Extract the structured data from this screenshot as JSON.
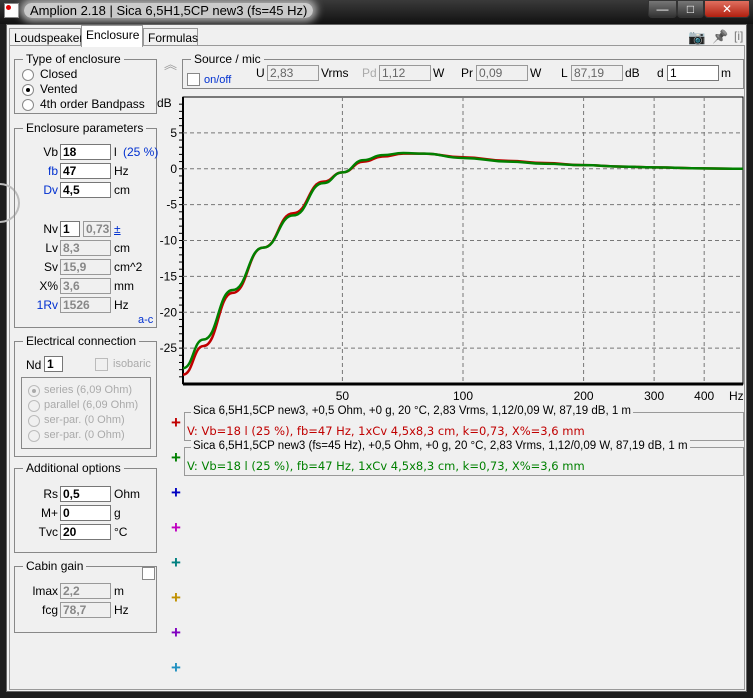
{
  "window": {
    "title": "Amplion 2.18 | Sica 6,5H1,5CP new3 (fs=45 Hz)",
    "minimize": "—",
    "maximize": "□",
    "close": "✕"
  },
  "tabs": [
    {
      "label": "Loudspeaker"
    },
    {
      "label": "Enclosure"
    },
    {
      "label": "Formulas"
    }
  ],
  "toolbar": {
    "camera": "📷",
    "pin": "📌",
    "info": "[i]"
  },
  "type_of_enclosure": {
    "title": "Type of enclosure",
    "options": [
      "Closed",
      "Vented",
      "4th order Bandpass"
    ],
    "selected": "Vented"
  },
  "enclosure_parameters": {
    "title": "Enclosure parameters",
    "vb": {
      "label": "Vb",
      "value": "18",
      "unit": "l",
      "extra": "(25 %)"
    },
    "fb": {
      "label": "fb",
      "value": "47",
      "unit": "Hz"
    },
    "dv": {
      "label": "Dv",
      "value": "4,5",
      "unit": "cm"
    },
    "nv": {
      "label": "Nv",
      "value": "1",
      "k": "0,73",
      "pm": "±"
    },
    "lv": {
      "label": "Lv",
      "value": "8,3",
      "unit": "cm"
    },
    "sv": {
      "label": "Sv",
      "value": "15,9",
      "unit": "cm^2"
    },
    "xp": {
      "label": "X%",
      "value": "3,6",
      "unit": "mm"
    },
    "rv": {
      "label": "1Rv",
      "value": "1526",
      "unit": "Hz"
    },
    "ac": "a-c"
  },
  "electrical": {
    "title": "Electrical connection",
    "nd_label": "Nd",
    "nd": "1",
    "isobaric": "isobaric",
    "options": [
      "series (6,09 Ohm)",
      "parallel (6,09 Ohm)",
      "ser-par. (0 Ohm)",
      "ser-par. (0 Ohm)"
    ]
  },
  "additional": {
    "title": "Additional options",
    "rs": {
      "label": "Rs",
      "value": "0,5",
      "unit": "Ohm"
    },
    "m": {
      "label": "M+",
      "value": "0",
      "unit": "g"
    },
    "tvc": {
      "label": "Tvc",
      "value": "20",
      "unit": "°C"
    }
  },
  "cabin": {
    "title": "Cabin gain",
    "lmax": {
      "label": "lmax",
      "value": "2,2",
      "unit": "m"
    },
    "fcg": {
      "label": "fcg",
      "value": "78,7",
      "unit": "Hz"
    }
  },
  "source": {
    "title": "Source / mic",
    "onoff": "on/off",
    "u": {
      "label": "U",
      "value": "2,83",
      "unit": "Vrms"
    },
    "pd": {
      "label": "Pd",
      "value": "1,12",
      "unit": "W"
    },
    "pr": {
      "label": "Pr",
      "value": "0,09",
      "unit": "W"
    },
    "l": {
      "label": "L",
      "value": "87,19",
      "unit": "dB"
    },
    "d": {
      "label": "d",
      "value": "1",
      "unit": "m"
    }
  },
  "collapse": "︽",
  "legend": [
    {
      "title": "Sica 6,5H1,5CP new3, +0,5 Ohm, +0 g, 20 °C, 2,83 Vrms, 1,12/0,09 W, 87,19 dB, 1 m",
      "desc": "V: Vb=18 l (25 %), fb=47 Hz, 1xCv 4,5x8,3 cm, k=0,73, X%=3,6 mm",
      "color": "#c00000"
    },
    {
      "title": "Sica 6,5H1,5CP new3 (fs=45 Hz), +0,5 Ohm, +0 g, 20 °C, 2,83 Vrms, 1,12/0,09 W, 87,19 dB, 1 m",
      "desc": "V: Vb=18 l (25 %), fb=47 Hz, 1xCv 4,5x8,3 cm, k=0,73, X%=3,6 mm",
      "color": "#008000"
    }
  ],
  "slot_colors": [
    "#c00000",
    "#008000",
    "#0000c0",
    "#c000c0",
    "#008080",
    "#c09000",
    "#8000c0",
    "#2090c0"
  ],
  "chart_data": {
    "type": "line",
    "ylabel": "dB",
    "xlabel": "Hz",
    "xscale": "log",
    "xlim": [
      20,
      500
    ],
    "ylim": [
      -30,
      10
    ],
    "yticks": [
      5,
      0,
      -5,
      -10,
      -15,
      -20,
      -25
    ],
    "xticks": [
      50,
      100,
      200,
      300,
      400
    ],
    "grid": true,
    "series": [
      {
        "name": "Sica 6,5H1,5CP new3",
        "color": "#c00000",
        "x": [
          20,
          22.5,
          26.6,
          31.7,
          37.7,
          44.8,
          50,
          56.5,
          63,
          71,
          80,
          100,
          130,
          160,
          200,
          250,
          300,
          400,
          500
        ],
        "y": [
          -28.7,
          -24.7,
          -17.3,
          -11,
          -6.2,
          -1.8,
          -0.5,
          1,
          1.7,
          2.1,
          2.1,
          1.6,
          1.1,
          0.8,
          0.5,
          0.3,
          0.2,
          0.05,
          0
        ]
      },
      {
        "name": "Sica 6,5H1,5CP new3 (fs=45 Hz)",
        "color": "#008000",
        "x": [
          20,
          22.5,
          26.6,
          31.7,
          37.7,
          44.8,
          50,
          56.5,
          63,
          71,
          80,
          100,
          130,
          160,
          200,
          250,
          300,
          400,
          500
        ],
        "y": [
          -27.8,
          -23.8,
          -16.9,
          -11,
          -6.5,
          -2,
          -0.5,
          1.2,
          1.9,
          2.2,
          2.1,
          1.5,
          1,
          0.7,
          0.5,
          0.3,
          0.2,
          0.05,
          0
        ]
      }
    ]
  }
}
